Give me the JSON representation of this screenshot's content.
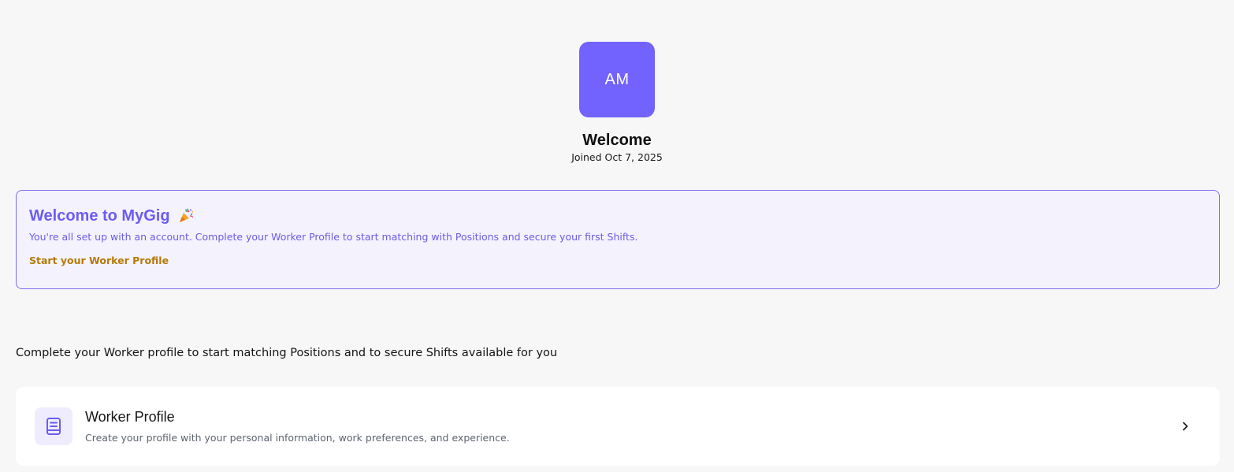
{
  "header": {
    "avatar_initials": "AM",
    "title": "Welcome",
    "joined": "Joined Oct 7, 2025"
  },
  "banner": {
    "title": "Welcome to MyGig",
    "icon": "party-popper-icon",
    "text": "You're all set up with an account. Complete your Worker Profile to start matching with Positions and secure your first Shifts.",
    "link_label": "Start your Worker Profile"
  },
  "section": {
    "intro": "Complete your Worker profile to start matching Positions and to secure Shifts available for you"
  },
  "cards": [
    {
      "icon": "document-icon",
      "title": "Worker Profile",
      "description": "Create your profile with your personal information, work preferences, and experience."
    }
  ],
  "colors": {
    "accent": "#7262fe",
    "banner_bg": "#f4f2fd",
    "banner_border": "#7b6ef0",
    "link": "#b57a0a",
    "page_bg": "#f7f7f7"
  }
}
